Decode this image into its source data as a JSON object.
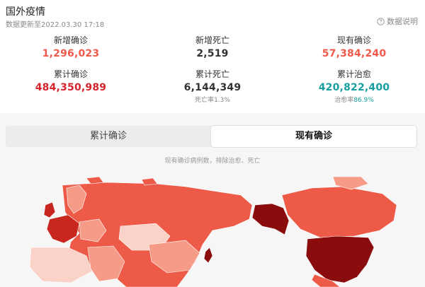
{
  "header": {
    "title": "国外疫情",
    "update_time": "数据更新至2022.03.30 17:18",
    "explain_label": "数据说明",
    "explain_icon": "help-circle-icon"
  },
  "stats": [
    {
      "label": "新增确诊",
      "value": "1,296,023",
      "color": "#f05a4a"
    },
    {
      "label": "新增死亡",
      "value": "2,519",
      "color": "#333333"
    },
    {
      "label": "现有确诊",
      "value": "57,384,240",
      "color": "#f05a4a"
    },
    {
      "label": "累计确诊",
      "value": "484,350,989",
      "color": "#d4232b"
    },
    {
      "label": "累计死亡",
      "value": "6,144,349",
      "color": "#333333",
      "sub_prefix": "死亡率",
      "sub_value": "1.3%"
    },
    {
      "label": "累计治愈",
      "value": "420,822,400",
      "color": "#179ea0",
      "sub_prefix": "治愈率",
      "sub_value": "86.9%"
    }
  ],
  "tabs": {
    "cumulative": "累计确诊",
    "current": "现有确诊"
  },
  "map": {
    "note": "现有确诊病例数，排除治愈、死亡",
    "colors": {
      "darkest": "#8a0c0c",
      "dark": "#c8271f",
      "mid": "#ee5a48",
      "light": "#f59b88",
      "lightest": "#fbd2c8"
    }
  }
}
